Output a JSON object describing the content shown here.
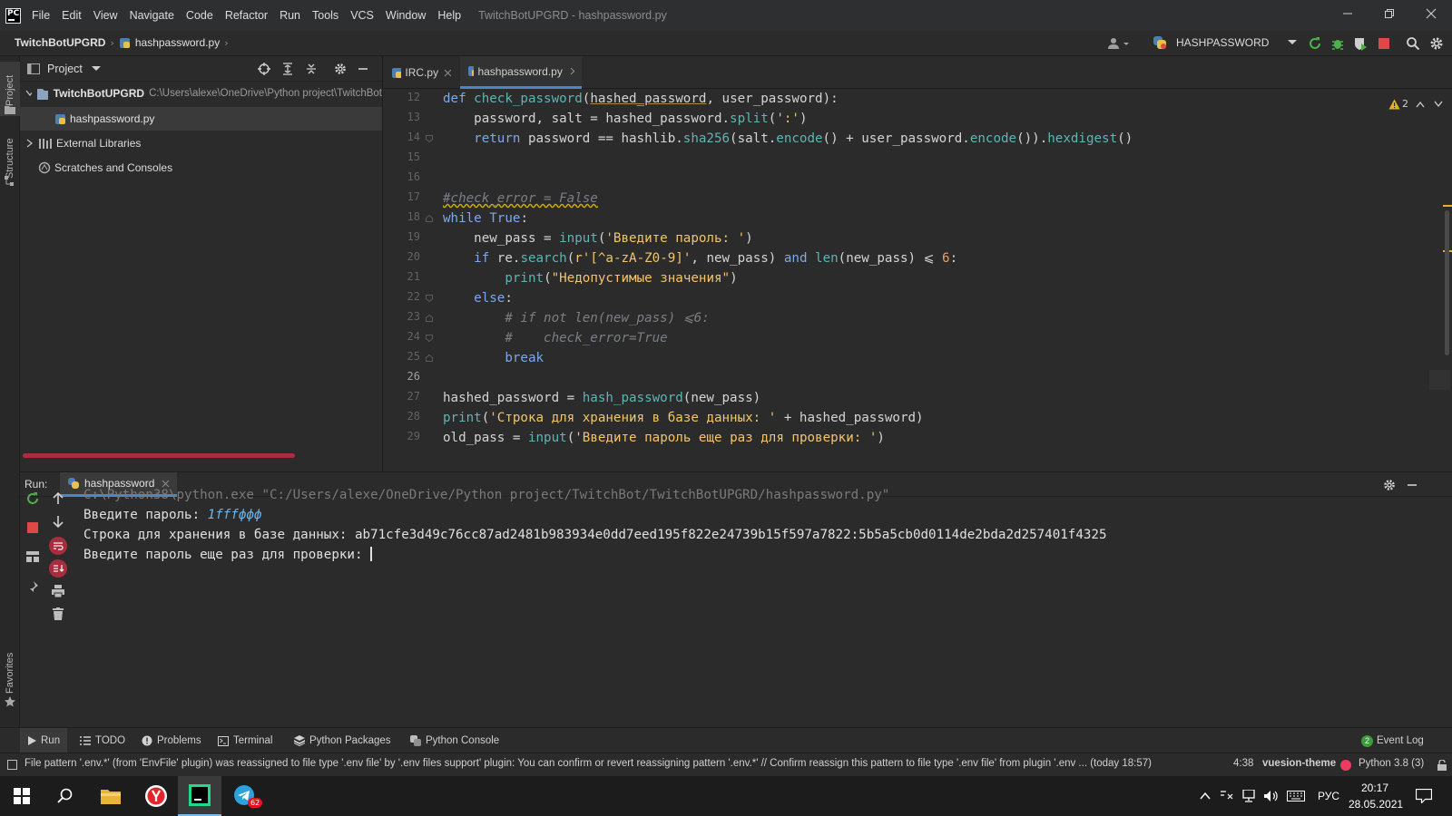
{
  "menu": {
    "items": [
      "File",
      "Edit",
      "View",
      "Navigate",
      "Code",
      "Refactor",
      "Run",
      "Tools",
      "VCS",
      "Window",
      "Help"
    ],
    "window_title": "TwitchBotUPGRD - hashpassword.py",
    "logo_text": "PC"
  },
  "navbar": {
    "project": "TwitchBotUPGRD",
    "file": "hashpassword.py",
    "run_config": "HASHPASSWORD"
  },
  "left_strip": {
    "project": "Project",
    "structure": "Structure",
    "favorites": "Favorites"
  },
  "project_panel": {
    "title": "Project",
    "tree": [
      {
        "label": "TwitchBotUPGRD",
        "path": "C:\\Users\\alexe\\OneDrive\\Python project\\TwitchBot"
      },
      {
        "label": "hashpassword.py"
      },
      {
        "label": "External Libraries"
      },
      {
        "label": "Scratches and Consoles"
      }
    ]
  },
  "editor": {
    "tabs": [
      {
        "label": "IRC.py",
        "active": false
      },
      {
        "label": "hashpassword.py",
        "active": true
      }
    ],
    "warnings": "2",
    "line_numbers": [
      "12",
      "13",
      "14",
      "15",
      "16",
      "17",
      "18",
      "19",
      "20",
      "21",
      "22",
      "23",
      "24",
      "25",
      "26",
      "27",
      "28",
      "29"
    ],
    "current_line": "26",
    "code": {
      "l12": {
        "a": "def ",
        "b": "check_password",
        "c": "(",
        "d": "hashed_password",
        "e": ", ",
        "f": "user_password",
        "g": "):"
      },
      "l13": {
        "a": "    password, salt = hashed_password.",
        "b": "split",
        "c": "(",
        "d": "':'",
        "e": ")"
      },
      "l14": {
        "a": "    ",
        "b": "return",
        "c": " password == hashlib.",
        "d": "sha256",
        "e": "(salt.",
        "f": "encode",
        "g": "() + user_password.",
        "h": "encode",
        "i": "()).",
        "j": "hexdigest",
        "k": "()"
      },
      "l17": {
        "a": "#check_error = False"
      },
      "l18": {
        "a": "while",
        "b": " ",
        "c": "True",
        "d": ":"
      },
      "l19": {
        "a": "    new_pass = ",
        "b": "input",
        "c": "(",
        "d": "'Введите пароль: '",
        "e": ")"
      },
      "l20": {
        "a": "    ",
        "b": "if",
        "c": " re.",
        "d": "search",
        "e": "(",
        "f": "r'[^a-zA-Z0-9]'",
        "g": ", new_pass) ",
        "h": "and",
        "i": " ",
        "j": "len",
        "k": "(new_pass) ⩽ ",
        "l": "6",
        "m": ":"
      },
      "l21": {
        "a": "        ",
        "b": "print",
        "c": "(",
        "d": "\"Недопустимые значения\"",
        "e": ")"
      },
      "l22": {
        "a": "    ",
        "b": "else",
        "c": ":"
      },
      "l23": {
        "a": "        # if not len(new_pass) ⩽6:"
      },
      "l24": {
        "a": "        #    check_error=True"
      },
      "l25": {
        "a": "        ",
        "b": "break"
      },
      "l27": {
        "a": "hashed_password = ",
        "b": "hash_password",
        "c": "(new_pass)"
      },
      "l28": {
        "a": "print",
        "b": "(",
        "c": "'Строка для хранения в базе данных: '",
        "d": " + hashed_password)"
      },
      "l29": {
        "a": "old_pass = ",
        "b": "input",
        "c": "(",
        "d": "'Введите пароль еще раз для проверки: '",
        "e": ")"
      }
    }
  },
  "run_panel": {
    "label": "Run:",
    "tab": "hashpassword",
    "console": {
      "command": "C:\\Python38\\python.exe \"C:/Users/alexe/OneDrive/Python project/TwitchBot/TwitchBotUPGRD/hashpassword.py\"",
      "prompt1": "Введите пароль: ",
      "input1": "1fffффф",
      "result": "Строка для хранения в базе данных: ab71cfe3d49c76cc87ad2481b983934e0dd7eed195f822e24739b15f597a7822:5b5a5cb0d0114de2bda2d257401f4325",
      "prompt2": "Введите пароль еще раз для проверки: "
    }
  },
  "bottom_tools": {
    "run": "Run",
    "todo": "TODO",
    "problems": "Problems",
    "terminal": "Terminal",
    "python_packages": "Python Packages",
    "python_console": "Python Console",
    "event_log": "Event Log",
    "event_count": "2"
  },
  "status": {
    "message": "File pattern '.env.*' (from 'EnvFile' plugin) was reassigned to file type '.env file' by '.env files support' plugin: You can confirm or revert reassigning pattern '.env.*' // Confirm reassign this pattern to file type '.env file' from plugin '.env ... (today 18:57)",
    "position": "4:38",
    "theme": "vuesion-theme",
    "interpreter": "Python 3.8 (3)"
  },
  "taskbar": {
    "lang": "РУС",
    "time": "20:17",
    "date": "28.05.2021",
    "telegram_badge": "62"
  },
  "colors": {
    "accent": "#4a88c7",
    "stop_red": "#e04848",
    "run_green": "#4db04d",
    "warning": "#e6b422"
  }
}
